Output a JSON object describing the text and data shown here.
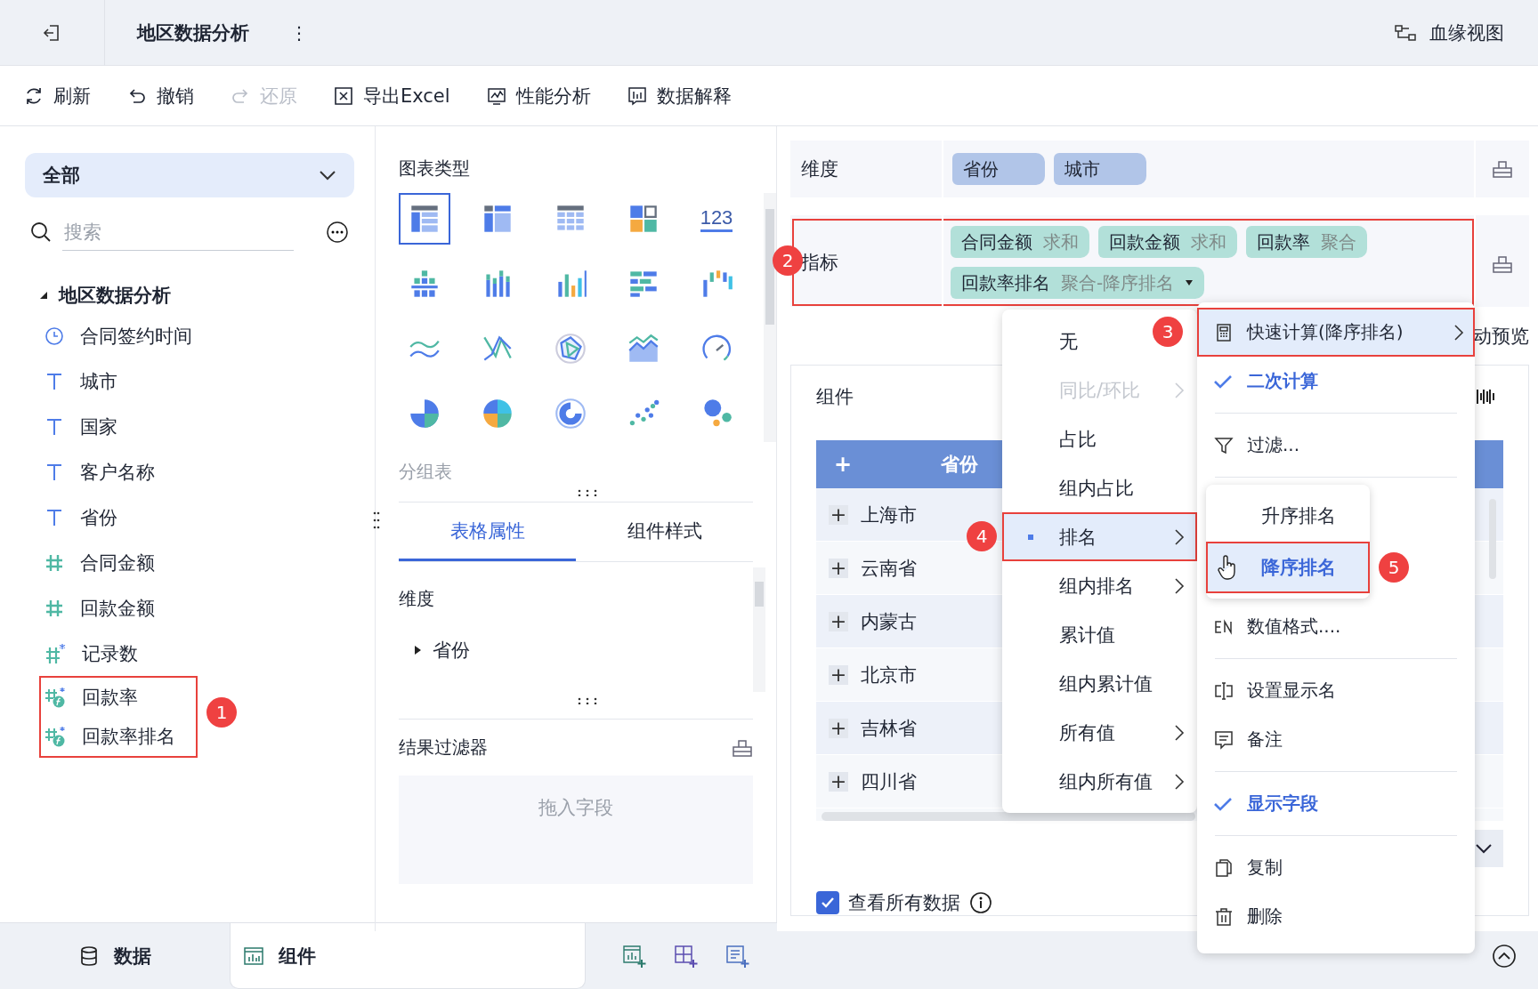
{
  "header": {
    "title": "地区数据分析",
    "more": "⋮",
    "lineage": "血缘视图"
  },
  "toolbar": [
    {
      "label": "刷新",
      "disabled": false
    },
    {
      "label": "撤销",
      "disabled": false
    },
    {
      "label": "还原",
      "disabled": true
    },
    {
      "label": "导出Excel",
      "disabled": false
    },
    {
      "label": "性能分析",
      "disabled": false
    },
    {
      "label": "数据解释",
      "disabled": false
    }
  ],
  "fields": {
    "filter": "全部",
    "search_placeholder": "搜索",
    "badge": "1",
    "tree": {
      "label": "地区数据分析",
      "expanded": true,
      "children": [
        {
          "label": "合同签约时间",
          "kind": "date",
          "annotated": false
        },
        {
          "label": "城市",
          "kind": "text",
          "annotated": false
        },
        {
          "label": "国家",
          "kind": "text",
          "annotated": false
        },
        {
          "label": "客户名称",
          "kind": "text",
          "annotated": false
        },
        {
          "label": "省份",
          "kind": "text",
          "annotated": false
        },
        {
          "label": "合同金额",
          "kind": "number",
          "annotated": false
        },
        {
          "label": "回款金额",
          "kind": "number",
          "annotated": false
        },
        {
          "label": "记录数",
          "kind": "count",
          "annotated": false
        },
        {
          "label": "回款率",
          "kind": "calc",
          "annotated": true
        },
        {
          "label": "回款率排名",
          "kind": "calc",
          "annotated": true
        }
      ]
    }
  },
  "chart_types": {
    "title": "图表类型",
    "current": "分组表",
    "items": [
      {
        "kind": "table",
        "selected": true
      },
      {
        "kind": "crosstab",
        "selected": false
      },
      {
        "kind": "detail",
        "selected": false
      },
      {
        "kind": "multi",
        "selected": false
      },
      {
        "kind": "kpi",
        "label": "123",
        "selected": false
      },
      {
        "kind": "grouped",
        "selected": false
      },
      {
        "kind": "stacked",
        "selected": false
      },
      {
        "kind": "bar",
        "selected": false
      },
      {
        "kind": "hbar",
        "selected": false
      },
      {
        "kind": "waterfall",
        "selected": false
      },
      {
        "kind": "line",
        "selected": false
      },
      {
        "kind": "crossline",
        "selected": false
      },
      {
        "kind": "radar",
        "selected": false
      },
      {
        "kind": "area",
        "selected": false
      },
      {
        "kind": "gauge",
        "selected": false
      },
      {
        "kind": "pie",
        "selected": false
      },
      {
        "kind": "pie4",
        "selected": false
      },
      {
        "kind": "ring",
        "selected": false
      },
      {
        "kind": "scatter",
        "selected": false
      },
      {
        "kind": "bubble",
        "selected": false
      }
    ]
  },
  "props_tabs": [
    {
      "label": "表格属性",
      "selected": true
    },
    {
      "label": "组件样式",
      "selected": false
    }
  ],
  "dimension_section": {
    "title": "维度",
    "items": [
      {
        "label": "省份",
        "expanded": false
      }
    ]
  },
  "result_filter": {
    "title": "结果过滤器",
    "placeholder": "拖入字段"
  },
  "dimensions": {
    "label": "维度",
    "chips": [
      "省份",
      "城市"
    ]
  },
  "metrics": {
    "label": "指标",
    "badge": "2",
    "chips": [
      {
        "name": "合同金额",
        "agg": "求和",
        "dropdown": false
      },
      {
        "name": "回款金额",
        "agg": "求和",
        "dropdown": false
      },
      {
        "name": "回款率",
        "agg": "聚合",
        "dropdown": false
      },
      {
        "name": "回款率排名",
        "agg": "聚合-降序排名",
        "dropdown": true
      }
    ]
  },
  "auto_preview": "动预览",
  "component": {
    "title": "组件",
    "table": {
      "header": {
        "expand": "+",
        "label": "省份"
      },
      "rows": [
        {
          "expand": "+",
          "label": "上海市"
        },
        {
          "expand": "+",
          "label": "云南省"
        },
        {
          "expand": "+",
          "label": "内蒙古"
        },
        {
          "expand": "+",
          "label": "北京市"
        },
        {
          "expand": "+",
          "label": "吉林省"
        },
        {
          "expand": "+",
          "label": "四川省"
        }
      ]
    },
    "show_all": {
      "label": "查看所有数据",
      "checked": true
    }
  },
  "calc_menu": {
    "items": [
      {
        "label": "无",
        "disabled": false,
        "submenu": false,
        "selected": false
      },
      {
        "label": "同比/环比",
        "disabled": true,
        "submenu": true,
        "selected": false
      },
      {
        "label": "占比",
        "disabled": false,
        "submenu": false,
        "selected": false
      },
      {
        "label": "组内占比",
        "disabled": false,
        "submenu": false,
        "selected": false
      },
      {
        "label": "排名",
        "disabled": false,
        "submenu": true,
        "selected": true,
        "badge": "4"
      },
      {
        "label": "组内排名",
        "disabled": false,
        "submenu": true,
        "selected": false
      },
      {
        "label": "累计值",
        "disabled": false,
        "submenu": false,
        "selected": false
      },
      {
        "label": "组内累计值",
        "disabled": false,
        "submenu": false,
        "selected": false
      },
      {
        "label": "所有值",
        "disabled": false,
        "submenu": true,
        "selected": false
      },
      {
        "label": "组内所有值",
        "disabled": false,
        "submenu": true,
        "selected": false
      }
    ]
  },
  "field_menu": {
    "items": [
      {
        "kind": "item",
        "label": "快速计算(降序排名)",
        "submenu": true,
        "highlighted": true,
        "badge": "3"
      },
      {
        "kind": "check",
        "label": "二次计算",
        "checked": true
      },
      {
        "kind": "divider"
      },
      {
        "kind": "item",
        "label": "过滤...",
        "submenu": false,
        "highlighted": false
      },
      {
        "kind": "divider"
      },
      {
        "kind": "sort_menu",
        "items": [
          {
            "label": "升序排名",
            "selected": false
          },
          {
            "label": "降序排名",
            "selected": true,
            "badge": "5"
          }
        ]
      },
      {
        "kind": "item",
        "label": "数值格式....",
        "submenu": false,
        "highlighted": false
      },
      {
        "kind": "divider"
      },
      {
        "kind": "item",
        "label": "设置显示名",
        "submenu": false,
        "highlighted": false
      },
      {
        "kind": "item",
        "label": "备注",
        "submenu": false,
        "highlighted": false
      },
      {
        "kind": "divider"
      },
      {
        "kind": "check",
        "label": "显示字段",
        "checked": true
      },
      {
        "kind": "divider"
      },
      {
        "kind": "item",
        "label": "复制",
        "submenu": false,
        "highlighted": false
      },
      {
        "kind": "item",
        "label": "删除",
        "submenu": false,
        "highlighted": false
      }
    ]
  },
  "bottom_tabs": [
    {
      "label": "数据",
      "selected": false
    },
    {
      "label": "组件",
      "selected": true
    }
  ]
}
